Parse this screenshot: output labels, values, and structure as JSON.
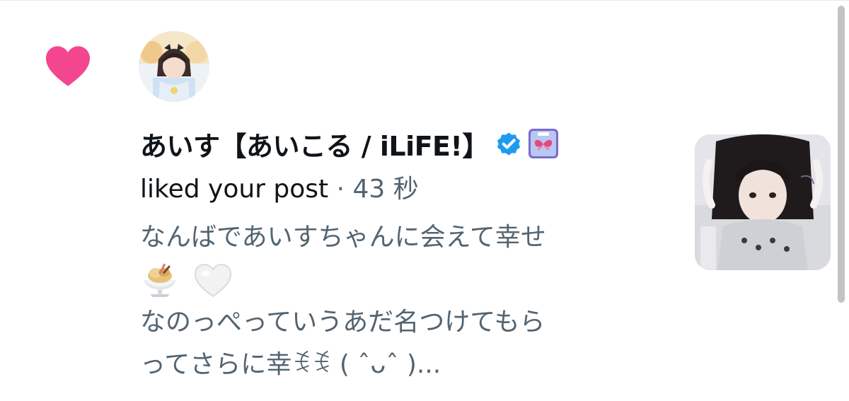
{
  "notification": {
    "type": "like",
    "author": {
      "display_name": "あいす【あいこる / iLiFE!】",
      "verified": true,
      "affiliate_badge": "iLiFE! butterfly badge"
    },
    "action_text": "liked your post",
    "separator": "·",
    "timestamp": "43 秒",
    "post": {
      "line1": "なんばであいすちゃんに会えて幸せ",
      "emojis": [
        "parfait-icon",
        "white-heart-icon"
      ],
      "line3": "なのっぺっていうあだ名つけてもら",
      "line4": "ってさらに幸ꉂꉂ ( ˆᴗˆ )..."
    }
  },
  "colors": {
    "like_heart": "#f91880",
    "verified": "#1d9bf0",
    "primary_text": "#0f1419",
    "secondary_text": "#536471"
  }
}
